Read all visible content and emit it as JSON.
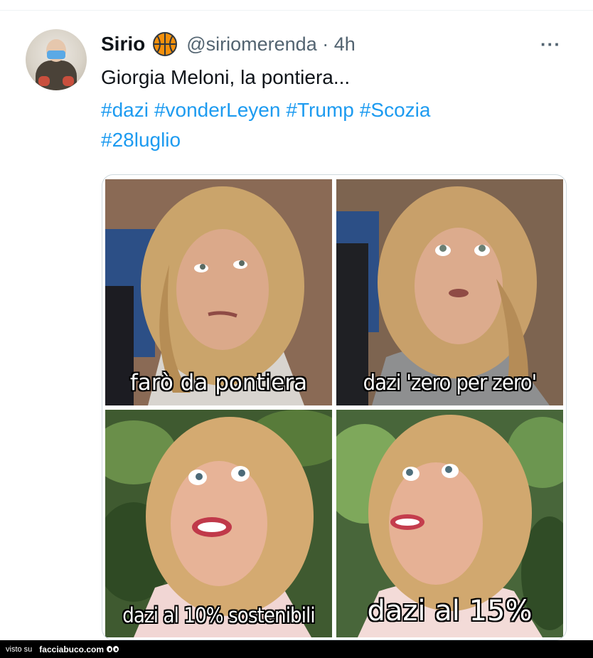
{
  "tweet": {
    "author_name": "Sirio",
    "handle_line": "@siriomerenda · 4h",
    "more_label": "···",
    "text": "Giorgia Meloni, la pontiera...",
    "hashtags": [
      "#dazi",
      "#vonderLeyen",
      "#Trump",
      "#Scozia",
      "#28luglio"
    ],
    "author_emoji_icon": "basketball-icon",
    "link_color": "#1d9bf0"
  },
  "meme": {
    "captions": [
      "farò da pontiera",
      "dazi 'zero per zero'",
      "dazi al 10% sostenibili",
      "dazi al 15%"
    ]
  },
  "footer": {
    "prefix": "visto su",
    "site": "facciabuco.com"
  }
}
